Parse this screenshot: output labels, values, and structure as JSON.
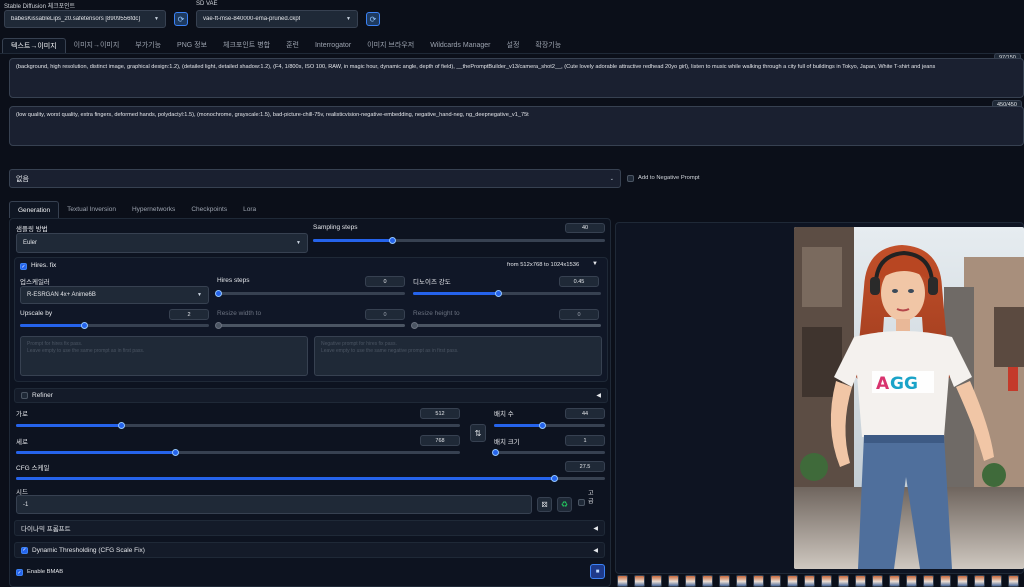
{
  "top": {
    "checkpoint_label": "Stable Diffusion 체크포인트",
    "checkpoint_value": "babesKissableLips_20.safetensors [8909556fdc]",
    "vae_label": "SD VAE",
    "vae_value": "vae-ft-mse-840000-ema-pruned.ckpt"
  },
  "tabs": [
    "텍스트→이미지",
    "이미지→이미지",
    "부가기능",
    "PNG 정보",
    "체크포인트 병합",
    "훈련",
    "Interrogator",
    "이미지 브라우저",
    "Wildcards Manager",
    "설정",
    "확장기능"
  ],
  "prompt": {
    "text": "(background, high resolution, distinct image, graphical design:1.2), (detailed light, detailed shadow:1.2), (F4, 1/800s, ISO 100, RAW, in magic hour, dynamic angle, depth of field), __thePromptBuilder_v13/camera_shot2__, (Cute lovely adorable attractive redhead 20yo girl), listen to music while walking through a city full of buildings in Tokyo, Japan, White T-shirt and jeans",
    "counter": "97/150"
  },
  "negative": {
    "text": "(low quality, worst quality, extra fingers, deformed hands, polydactyl:1.5), (monochrome, grayscale:1.5), bad-picture-chill-75v, realisticvision-negative-embedding, negative_hand-neg, ng_deepnegative_v1_75t",
    "counter": "450/450"
  },
  "styles": {
    "value": "없음",
    "add_negative_label": "Add to Negative Prompt"
  },
  "subtabs": [
    "Generation",
    "Textual Inversion",
    "Hypernetworks",
    "Checkpoints",
    "Lora"
  ],
  "sampler": {
    "label": "샘플링 방법",
    "value": "Euler",
    "steps_label": "Sampling steps",
    "steps_value": "40",
    "steps_fraction": 0.27
  },
  "hires": {
    "label": "Hires. fix",
    "info": "from 512x768  to 1024x1536",
    "upscaler_label": "업스케일러",
    "upscaler_value": "R-ESRGAN 4x+ Anime6B",
    "hires_steps_label": "Hires steps",
    "hires_steps_value": "0",
    "denoise_label": "디노이즈 강도",
    "denoise_value": "0.45",
    "upscale_label": "Upscale by",
    "upscale_value": "2",
    "resize_w_label": "Resize width to",
    "resize_w_value": "0",
    "resize_h_label": "Resize height to",
    "resize_h_value": "0",
    "prompt_ph1": "Prompt for hires fix pass.",
    "prompt_ph2": "Leave empty to use the same prompt as in first pass.",
    "neg_ph1": "Negative prompt for hires fix pass.",
    "neg_ph2": "Leave empty to use the same negative prompt as in first pass."
  },
  "refiner": {
    "label": "Refiner"
  },
  "size": {
    "width_label": "가로",
    "width_value": "512",
    "height_label": "세로",
    "height_value": "768",
    "batch_count_label": "배치 수",
    "batch_count_value": "44",
    "batch_size_label": "배치 크기",
    "batch_size_value": "1",
    "cfg_label": "CFG 스케일",
    "cfg_value": "27.5",
    "seed_label": "시드",
    "seed_value": "-1",
    "extra_label": "고급"
  },
  "dynamic_prompts": {
    "label": "다이나믹 프롬프트"
  },
  "dynamic_threshold": {
    "label": "Dynamic Thresholding (CFG Scale Fix)"
  },
  "bmab": {
    "label": "Enable BMAB"
  },
  "colors": {
    "accent": "#2563eb",
    "bg": "#0b0f19"
  }
}
